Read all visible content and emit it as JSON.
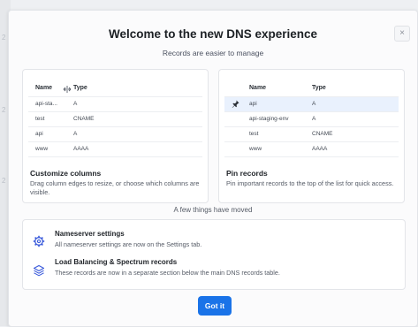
{
  "background": {
    "marks": [
      "2",
      "2",
      "2"
    ]
  },
  "modal": {
    "title": "Welcome to the new DNS experience",
    "subtitle": "Records are easier to manage",
    "close_symbol": "×",
    "accent_color": "#1a73e8"
  },
  "customize_card": {
    "headers": [
      "Name",
      "Type"
    ],
    "rows": [
      {
        "name": "api-sta...",
        "type": "A"
      },
      {
        "name": "test",
        "type": "CNAME"
      },
      {
        "name": "api",
        "type": "A"
      },
      {
        "name": "www",
        "type": "AAAA"
      }
    ],
    "title": "Customize columns",
    "description": "Drag column edges to resize, or choose which columns are visible.",
    "resize_icon": "column-resize-icon"
  },
  "pin_card": {
    "headers": [
      "Name",
      "Type"
    ],
    "rows": [
      {
        "name": "api",
        "type": "A",
        "pinned": true
      },
      {
        "name": "api-staging-env",
        "type": "A",
        "pinned": false
      },
      {
        "name": "test",
        "type": "CNAME",
        "pinned": false
      },
      {
        "name": "www",
        "type": "AAAA",
        "pinned": false
      }
    ],
    "title": "Pin records",
    "description": "Pin important records to the top of the list for quick access.",
    "pin_icon": "pin-icon"
  },
  "moved_label": "A few things have moved",
  "moved_items": [
    {
      "icon": "gear-icon",
      "title": "Nameserver settings",
      "description": "All nameserver settings are now on the Settings tab."
    },
    {
      "icon": "layers-icon",
      "title": "Load Balancing & Spectrum records",
      "description": "These records are now in a separate section below the main DNS records table."
    }
  ],
  "primary_button": {
    "label": "Got it"
  }
}
